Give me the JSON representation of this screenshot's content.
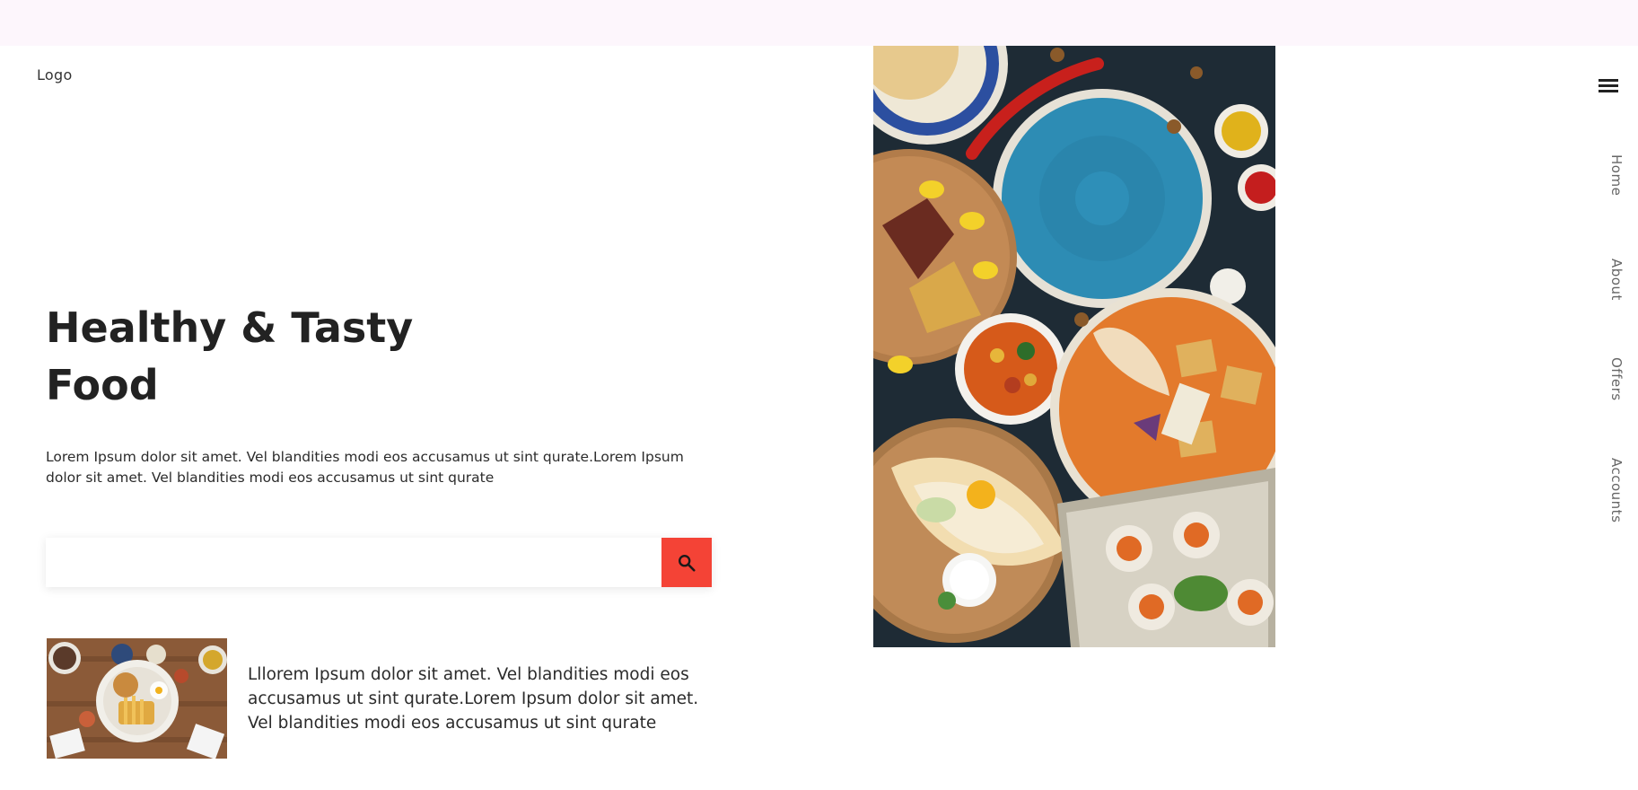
{
  "header": {
    "logo": "Logo"
  },
  "hero": {
    "title_line1": "Healthy & Tasty",
    "title_line2": "Food",
    "description": "Lorem Ipsum dolor sit amet. Vel blandities modi eos accusamus ut sint qurate.Lorem Ipsum dolor sit amet. Vel blandities modi eos accusamus ut sint qurate"
  },
  "search": {
    "placeholder": "",
    "value": "",
    "button_icon": "search-icon",
    "button_color": "#f44336"
  },
  "feature": {
    "text": "Lllorem Ipsum dolor sit amet. Vel blandities modi eos accusamus ut sint qurate.Lorem Ipsum dolor sit amet. Vel blandities modi eos accusamus ut sint qurate"
  },
  "nav": {
    "menu_icon": "hamburger-icon",
    "items": [
      {
        "label": "Home"
      },
      {
        "label": "About"
      },
      {
        "label": "Offers"
      },
      {
        "label": "Accounts"
      }
    ]
  },
  "colors": {
    "topbar": "#fdf6fc",
    "accent": "#f44336",
    "text": "#222222"
  }
}
